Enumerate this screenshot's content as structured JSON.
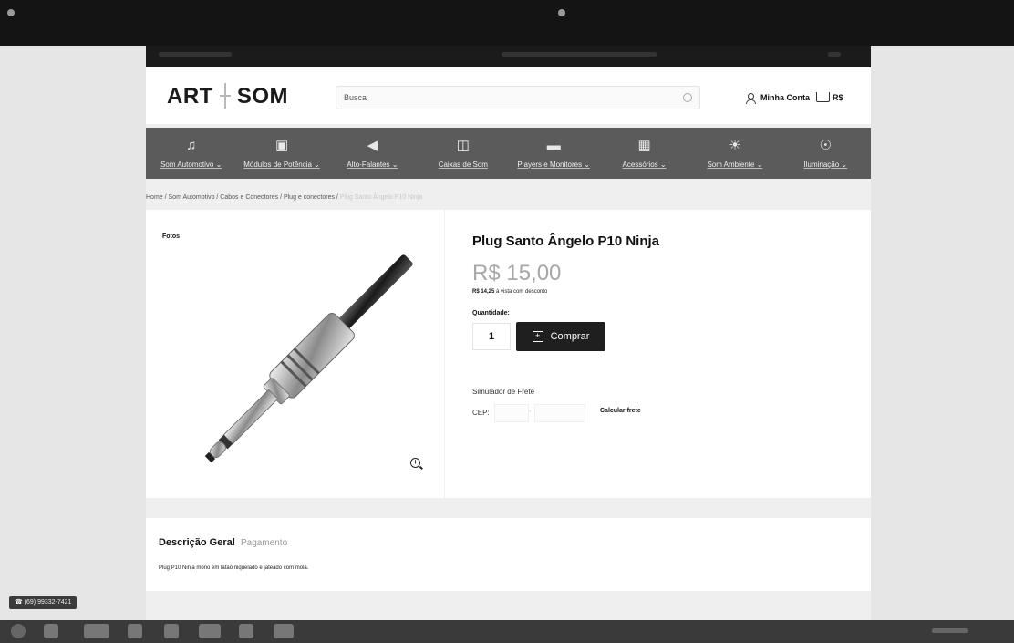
{
  "site": {
    "logo_left": "ART",
    "logo_right": "SOM",
    "search_placeholder": "Busca",
    "account_label": "Minha Conta",
    "cart_label": "R$"
  },
  "nav": [
    {
      "label": "Som Automotivo ⌄",
      "icon": "speaker-icon"
    },
    {
      "label": "Módulos de Potência ⌄",
      "icon": "amplifier-icon"
    },
    {
      "label": "Alto-Falantes ⌄",
      "icon": "loudspeaker-icon"
    },
    {
      "label": "Caixas de Som",
      "icon": "speaker-box-icon"
    },
    {
      "label": "Players e Monitores ⌄",
      "icon": "player-icon"
    },
    {
      "label": "Acessórios ⌄",
      "icon": "car-icon"
    },
    {
      "label": "Som Ambiente ⌄",
      "icon": "ambient-icon"
    },
    {
      "label": "Iluminação ⌄",
      "icon": "light-icon"
    }
  ],
  "breadcrumb": {
    "visible": "Home / Som Automotivo / Cabos e Conectores / Plug e conectores /",
    "faded": "Plug Santo Ângelo P10 Ninja"
  },
  "product": {
    "photos_label": "Fotos",
    "title": "Plug Santo Ângelo P10 Ninja",
    "price": "R$ 15,00",
    "discount_price": "R$ 14,25",
    "discount_text": " à vista com desconto",
    "quantity_label": "Quantidade:",
    "quantity": "1",
    "buy_label": "Comprar",
    "freight_label": "Simulador de Frete",
    "cep_label": "CEP:",
    "calc_label": "Calcular frete"
  },
  "description": {
    "tab_general": "Descrição Geral",
    "tab_payment": "Pagamento",
    "text": "Plug P10 Ninja mono em latão niquelado e jateado com mola."
  },
  "whatsapp_label": "(69) 99332-7421",
  "colors": {
    "nav_bg": "#5b5b5b",
    "buy_button": "#1f1f1f",
    "price": "#a7a7a7"
  }
}
